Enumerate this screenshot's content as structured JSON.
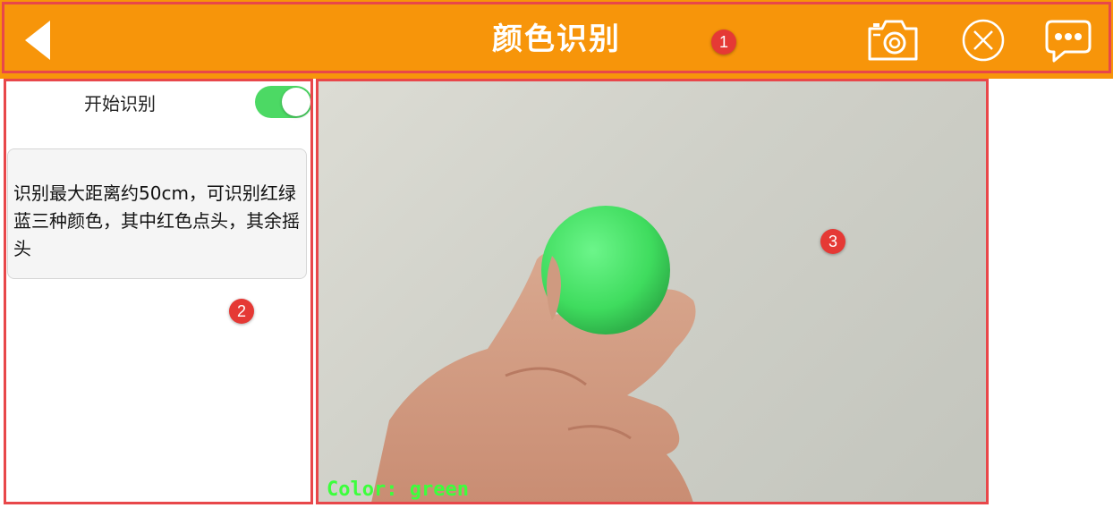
{
  "header": {
    "title": "颜色识别",
    "back_icon": "back-arrow-icon",
    "camera_icon": "camera-icon",
    "close_icon": "close-circle-icon",
    "chat_icon": "chat-bubble-icon",
    "background_color": "#f7950a"
  },
  "sidebar": {
    "toggle_label": "开始识别",
    "toggle_state": "on",
    "toggle_color": "#4cd964",
    "description": "识别最大距离约50cm，可识别红绿蓝三种颜色，其中红色点头，其余摇头"
  },
  "camera": {
    "overlay_text": "Color: green",
    "ball_color": "#4ee26a"
  },
  "annotations": {
    "badge1": "1",
    "badge2": "2",
    "badge3": "3",
    "color": "#e8474a"
  }
}
